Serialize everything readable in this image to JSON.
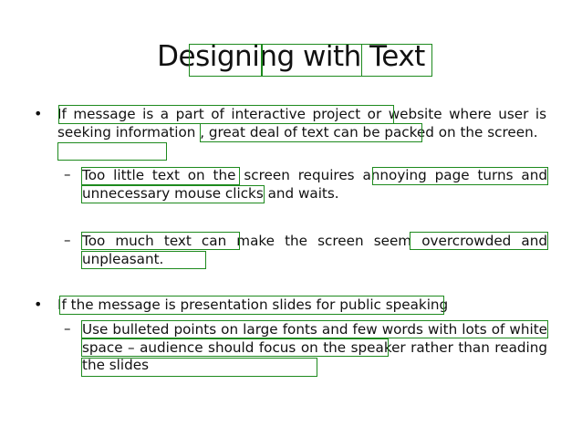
{
  "slide": {
    "title": "Designing with Text",
    "bullets": [
      {
        "marker": "•",
        "text": "If message is a part of interactive project  or website where user is seeking information , great deal of text can be packed on the screen.",
        "subitems": [
          {
            "marker": "–",
            "text": "Too little text on the screen requires annoying page turns and unnecessary mouse clicks and waits."
          },
          {
            "marker": "–",
            "text": "Too much text can make the screen seem overcrowded and unpleasant."
          }
        ]
      },
      {
        "marker": "•",
        "text": "If the message is presentation slides for public speaking",
        "subitems": [
          {
            "marker": "–",
            "text": "Use bulleted points on large fonts and few words with lots of white space – audience should focus on the speaker rather than reading the slides"
          }
        ]
      }
    ]
  },
  "colors": {
    "text": "#111111",
    "highlight_box": "#1e8a1e",
    "background": "#ffffff"
  }
}
